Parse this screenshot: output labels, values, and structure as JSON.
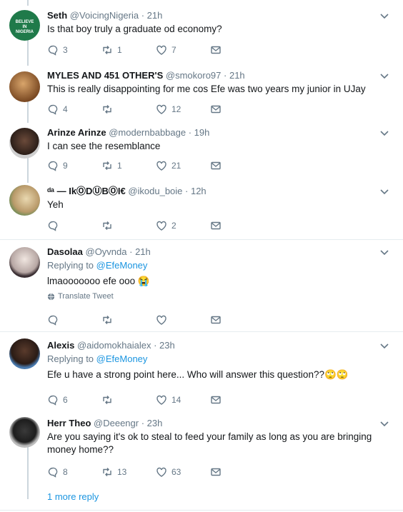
{
  "tweets": [
    {
      "name": "Seth",
      "handle": "@VoicingNigeria",
      "time": "21h",
      "text": "Is that boy truly a graduate od  economy?",
      "replies": "3",
      "retweets": "1",
      "likes": "7"
    },
    {
      "name": "MYLES AND 451 OTHER'S",
      "handle": "@smokoro97",
      "time": "21h",
      "text": "This is really disappointing for me cos Efe was two years my junior in UJay",
      "replies": "4",
      "retweets": "",
      "likes": "12"
    },
    {
      "name": "Arinze Arinze",
      "handle": "@modernbabbage",
      "time": "19h",
      "text": "I can see the resemblance",
      "replies": "9",
      "retweets": "1",
      "likes": "21"
    },
    {
      "name": "ᵈᵃ — IkⓄDⓊBⓄI€",
      "handle": "@ikodu_boie",
      "time": "12h",
      "text": "Yeh",
      "replies": "",
      "retweets": "",
      "likes": "2"
    },
    {
      "name": "Dasolaa",
      "handle": "@Oyvnda",
      "time": "21h",
      "replying_prefix": "Replying to",
      "replying_to": "@EfeMoney",
      "text": "lmaooooooo efe ooo 😭",
      "translate": "Translate Tweet",
      "replies": "",
      "retweets": "",
      "likes": ""
    },
    {
      "name": "Alexis",
      "handle": "@aidomokhaialex",
      "time": "23h",
      "replying_prefix": "Replying to",
      "replying_to": "@EfeMoney",
      "text": "Efe u have a strong point here... Who will answer this question??🙄🙄",
      "replies": "6",
      "retweets": "",
      "likes": "14"
    },
    {
      "name": "Herr Theo",
      "handle": "@Deeengr",
      "time": "23h",
      "text": "Are you saying it's ok to steal to feed your family as long as you are bringing money home??",
      "replies": "8",
      "retweets": "13",
      "likes": "63"
    }
  ],
  "more_reply": "1 more reply",
  "avatar_badge": "BELIEVE IN NIGERIA",
  "colors": {
    "accent": "#1b95e0",
    "muted": "#657786",
    "border": "#e6ecf0",
    "thread": "#ccd6dd"
  }
}
